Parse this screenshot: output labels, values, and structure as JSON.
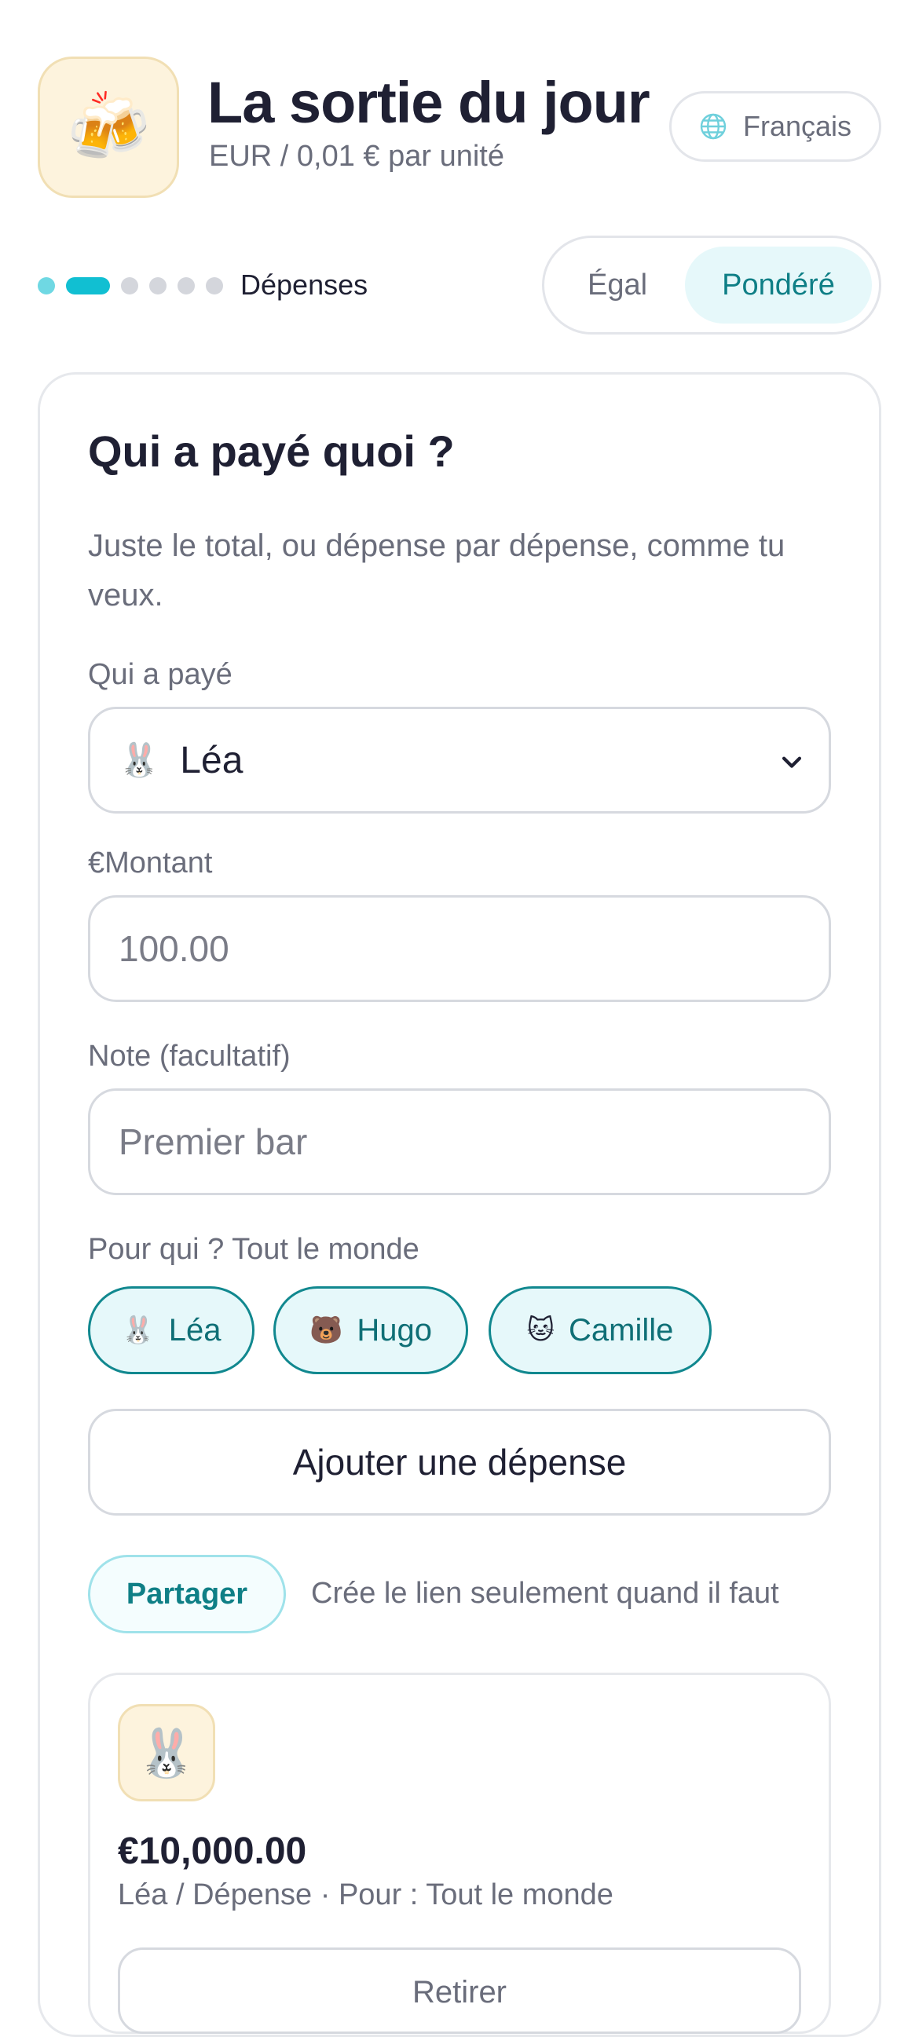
{
  "header": {
    "app_emoji": "🍻",
    "title": "La sortie du jour",
    "subtitle": "EUR / 0,01 € par unité",
    "language_label": "Français"
  },
  "progress": {
    "total_steps": 6,
    "current_step": 2,
    "label": "Dépenses"
  },
  "split_mode": {
    "options": [
      "Égal",
      "Pondéré"
    ],
    "selected": "Pondéré"
  },
  "form": {
    "title": "Qui a payé quoi ?",
    "description": "Juste le total, ou dépense par dépense, comme tu veux.",
    "payer_label": "Qui a payé",
    "payer_emoji": "🐰",
    "payer_value": "Léa",
    "amount_label": "€Montant",
    "amount_placeholder": "100.00",
    "note_label": "Note (facultatif)",
    "note_placeholder": "Premier bar",
    "for_whom_label": "Pour qui ? Tout le monde",
    "participants": [
      {
        "emoji": "🐰",
        "name": "Léa",
        "selected": true
      },
      {
        "emoji": "🐻",
        "name": "Hugo",
        "selected": true
      },
      {
        "emoji": "🐱",
        "name": "Camille",
        "selected": true
      }
    ],
    "add_button": "Ajouter une dépense",
    "share_button": "Partager",
    "share_note": "Crée le lien seulement quand il faut"
  },
  "expense": {
    "avatar_emoji": "🐰",
    "amount": "€10,000.00",
    "meta": "Léa / Dépense  ·  Pour : Tout le monde",
    "remove_button": "Retirer"
  },
  "colors": {
    "accent": "#11bfd2",
    "accent_dark": "#0f7f86",
    "chip_bg": "#e6f8fa",
    "text": "#1f2033",
    "muted": "#6a6d7b"
  }
}
